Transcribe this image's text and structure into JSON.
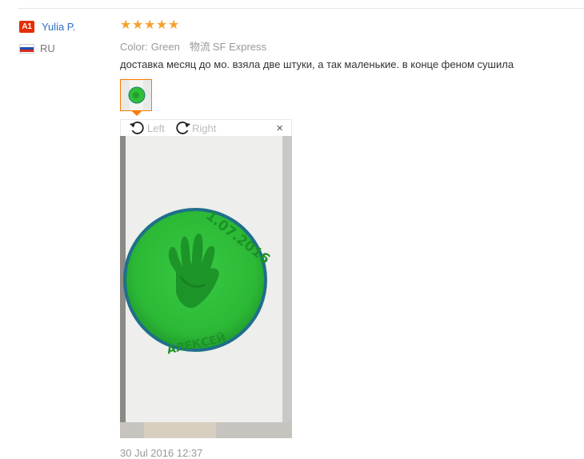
{
  "user": {
    "level_badge": "A1",
    "name": "Yulia P.",
    "country": "RU"
  },
  "review": {
    "rating": 5,
    "color_label": "Color:",
    "color_value": "Green",
    "shipping_label": "物流",
    "shipping_value": "SF Express",
    "text": "доставка месяц до мо. взяла две штуки, а так маленькие. в конце феном сушила",
    "date": "30 Jul 2016 12:37"
  },
  "viewer": {
    "rotate_left_label": "Left",
    "rotate_right_label": "Right",
    "close_label": "×"
  },
  "photo": {
    "plate_date": "1.07.2016",
    "plate_name": "АЛЕКСЕЙ"
  },
  "colors": {
    "badge": "#e62e04",
    "username": "#2d6fc4",
    "star": "#f7a12c",
    "thumb_border": "#ff7a00",
    "clay_green": "#2fbf3a"
  },
  "icons": {
    "rotate_left": "rotate-ccw-icon",
    "rotate_right": "rotate-cw-icon",
    "close": "close-icon",
    "star": "star-icon",
    "flag": "flag-ru-icon"
  }
}
